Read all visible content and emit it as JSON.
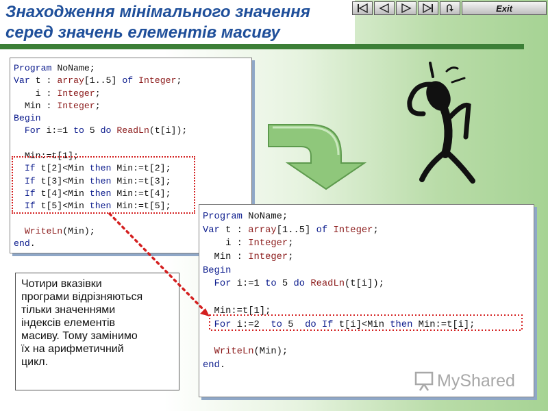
{
  "header": {
    "title_lines": [
      "Знаходження мінімального значення",
      "серед значень елементів масиву"
    ]
  },
  "nav": {
    "buttons": [
      "first-icon",
      "prev-icon",
      "next-icon",
      "last-icon",
      "return-icon"
    ],
    "exit_label": "Exit"
  },
  "code_original": {
    "lines": [
      [
        [
          "kw",
          "Program"
        ],
        [
          "tx",
          " NoName;"
        ]
      ],
      [
        [
          "kw",
          "Var"
        ],
        [
          "tx",
          " t : "
        ],
        [
          "ty",
          "array"
        ],
        [
          "tx",
          "[1..5] "
        ],
        [
          "kw",
          "of"
        ],
        [
          "tx",
          " "
        ],
        [
          "ty",
          "Integer"
        ],
        [
          "tx",
          ";"
        ]
      ],
      [
        [
          "tx",
          "    i : "
        ],
        [
          "ty",
          "Integer"
        ],
        [
          "tx",
          ";"
        ]
      ],
      [
        [
          "tx",
          "  Min : "
        ],
        [
          "ty",
          "Integer"
        ],
        [
          "tx",
          ";"
        ]
      ],
      [
        [
          "kw",
          "Begin"
        ]
      ],
      [
        [
          "tx",
          "  "
        ],
        [
          "kw",
          "For"
        ],
        [
          "tx",
          " i:=1 "
        ],
        [
          "kw",
          "to"
        ],
        [
          "tx",
          " 5 "
        ],
        [
          "kw",
          "do"
        ],
        [
          "tx",
          " "
        ],
        [
          "ty",
          "ReadLn"
        ],
        [
          "tx",
          "(t[i]);"
        ]
      ],
      [
        [
          "tx",
          ""
        ]
      ],
      [
        [
          "tx",
          "  Min:=t[1];"
        ]
      ],
      [
        [
          "tx",
          "  "
        ],
        [
          "kw",
          "If"
        ],
        [
          "tx",
          " t[2]<Min "
        ],
        [
          "kw",
          "then"
        ],
        [
          "tx",
          " Min:=t[2];"
        ]
      ],
      [
        [
          "tx",
          "  "
        ],
        [
          "kw",
          "If"
        ],
        [
          "tx",
          " t[3]<Min "
        ],
        [
          "kw",
          "then"
        ],
        [
          "tx",
          " Min:=t[3];"
        ]
      ],
      [
        [
          "tx",
          "  "
        ],
        [
          "kw",
          "If"
        ],
        [
          "tx",
          " t[4]<Min "
        ],
        [
          "kw",
          "then"
        ],
        [
          "tx",
          " Min:=t[4];"
        ]
      ],
      [
        [
          "tx",
          "  "
        ],
        [
          "kw",
          "If"
        ],
        [
          "tx",
          " t[5]<Min "
        ],
        [
          "kw",
          "then"
        ],
        [
          "tx",
          " Min:=t[5];"
        ]
      ],
      [
        [
          "tx",
          ""
        ]
      ],
      [
        [
          "tx",
          "  "
        ],
        [
          "ty",
          "WriteLn"
        ],
        [
          "tx",
          "(Min);"
        ]
      ],
      [
        [
          "kw",
          "end"
        ],
        [
          "tx",
          "."
        ]
      ]
    ]
  },
  "code_improved": {
    "lines": [
      [
        [
          "kw",
          "Program"
        ],
        [
          "tx",
          " NoName;"
        ]
      ],
      [
        [
          "kw",
          "Var"
        ],
        [
          "tx",
          " t : "
        ],
        [
          "ty",
          "array"
        ],
        [
          "tx",
          "[1..5] "
        ],
        [
          "kw",
          "of"
        ],
        [
          "tx",
          " "
        ],
        [
          "ty",
          "Integer"
        ],
        [
          "tx",
          ";"
        ]
      ],
      [
        [
          "tx",
          "    i : "
        ],
        [
          "ty",
          "Integer"
        ],
        [
          "tx",
          ";"
        ]
      ],
      [
        [
          "tx",
          "  Min : "
        ],
        [
          "ty",
          "Integer"
        ],
        [
          "tx",
          ";"
        ]
      ],
      [
        [
          "kw",
          "Begin"
        ]
      ],
      [
        [
          "tx",
          "  "
        ],
        [
          "kw",
          "For"
        ],
        [
          "tx",
          " i:=1 "
        ],
        [
          "kw",
          "to"
        ],
        [
          "tx",
          " 5 "
        ],
        [
          "kw",
          "do"
        ],
        [
          "tx",
          " "
        ],
        [
          "ty",
          "ReadLn"
        ],
        [
          "tx",
          "(t[i]);"
        ]
      ],
      [
        [
          "tx",
          ""
        ]
      ],
      [
        [
          "tx",
          "  Min:=t[1];"
        ]
      ],
      [
        [
          "tx",
          "  "
        ],
        [
          "kw",
          "For"
        ],
        [
          "tx",
          " i:=2  "
        ],
        [
          "kw",
          "to"
        ],
        [
          "tx",
          " 5  "
        ],
        [
          "kw",
          "do"
        ],
        [
          "tx",
          " "
        ],
        [
          "kw",
          "If"
        ],
        [
          "tx",
          " t[i]<Min "
        ],
        [
          "kw",
          "then"
        ],
        [
          "tx",
          " Min:=t[i];"
        ]
      ],
      [
        [
          "tx",
          ""
        ]
      ],
      [
        [
          "tx",
          "  "
        ],
        [
          "ty",
          "WriteLn"
        ],
        [
          "tx",
          "(Min);"
        ]
      ],
      [
        [
          "kw",
          "end"
        ],
        [
          "tx",
          "."
        ]
      ]
    ]
  },
  "note": {
    "lines": [
      "Чотири вказівки",
      "програми відрізняються",
      "тільки значеннями",
      "індексів елементів",
      "масиву. Тому замінимо",
      "їх на арифметичний",
      "цикл."
    ]
  },
  "watermark": {
    "text": "MyShared"
  },
  "colors": {
    "title": "#1f4f9a",
    "keyword": "#0a1a8c",
    "type": "#8b1a1a",
    "dotted": "#d42020",
    "arrow": "#6fae5a"
  }
}
